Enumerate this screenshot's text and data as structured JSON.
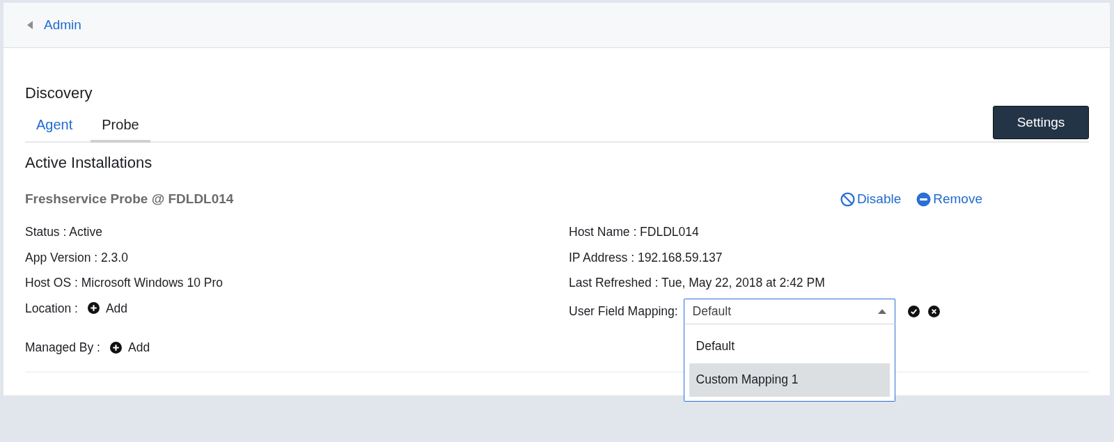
{
  "breadcrumb": {
    "label": "Admin"
  },
  "page_title": "Discovery",
  "tabs": [
    {
      "label": "Agent",
      "selected": false
    },
    {
      "label": "Probe",
      "selected": true
    }
  ],
  "settings_button": "Settings",
  "section_title": "Active Installations",
  "installation": {
    "name": "Freshservice Probe @ FDLDL014",
    "actions": [
      {
        "kind": "disable",
        "label": "Disable"
      },
      {
        "kind": "remove",
        "label": "Remove"
      }
    ],
    "left_fields": [
      {
        "kind": "text",
        "text": "Status : Active"
      },
      {
        "kind": "text",
        "text": "App Version : 2.3.0"
      },
      {
        "kind": "text",
        "text": "Host OS : Microsoft Windows 10 Pro"
      },
      {
        "kind": "add",
        "label": "Location :",
        "action": "Add"
      },
      {
        "kind": "add",
        "label": "Managed By :",
        "action": "Add"
      }
    ],
    "right_fields": [
      {
        "kind": "text",
        "text": "Host Name : FDLDL014"
      },
      {
        "kind": "text",
        "text": "IP Address : 192.168.59.137"
      },
      {
        "kind": "text",
        "text": "Last Refreshed : Tue, May 22, 2018 at 2:42 PM"
      }
    ],
    "user_field_mapping": {
      "label": "User Field Mapping:",
      "value": "Default",
      "expanded": true,
      "options": [
        {
          "label": "Default",
          "highlighted": false
        },
        {
          "label": "Custom Mapping 1",
          "highlighted": true
        }
      ]
    }
  }
}
